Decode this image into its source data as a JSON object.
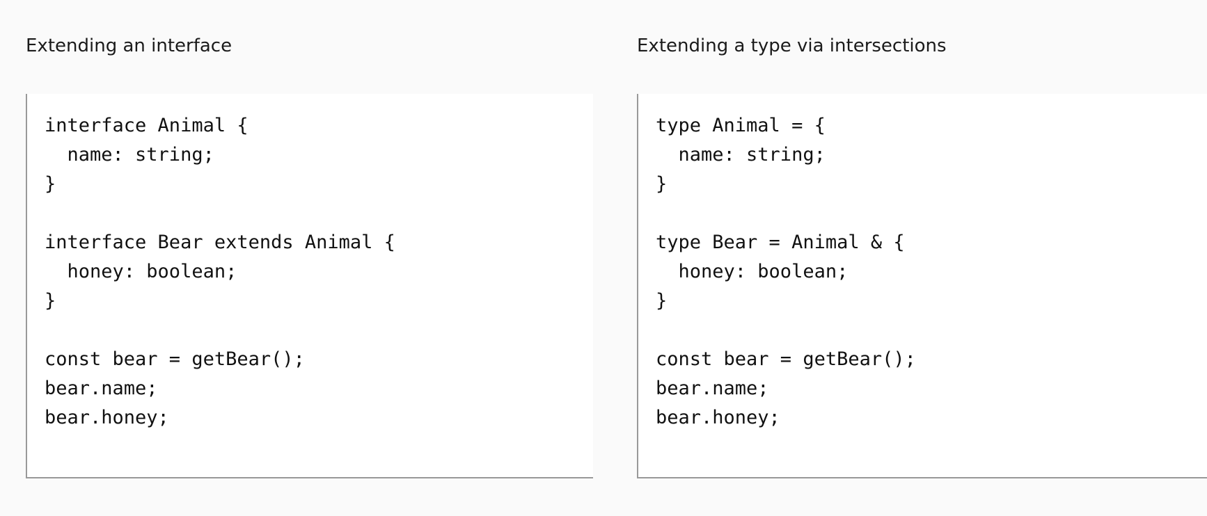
{
  "left": {
    "caption": "Extending an interface",
    "code_lines": [
      "interface Animal {",
      "  name: string;",
      "}",
      "",
      "interface Bear extends Animal {",
      "  honey: boolean;",
      "}",
      "",
      "const bear = getBear();",
      "bear.name;",
      "bear.honey;"
    ]
  },
  "right": {
    "caption": "Extending a type via intersections",
    "code_lines": [
      "type Animal = {",
      "  name: string;",
      "}",
      "",
      "type Bear = Animal & {",
      "  honey: boolean;",
      "}",
      "",
      "const bear = getBear();",
      "bear.name;",
      "bear.honey;"
    ]
  }
}
